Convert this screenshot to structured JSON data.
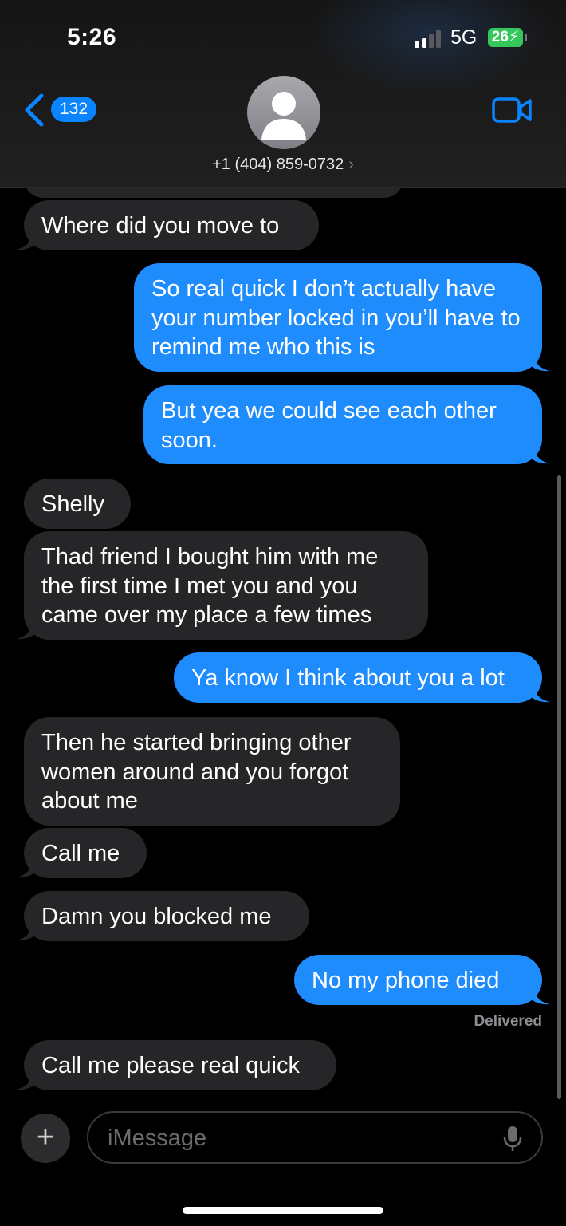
{
  "status_bar": {
    "time": "5:26",
    "network": "5G",
    "battery": "26"
  },
  "header": {
    "back_count": "132",
    "contact": "+1 (404) 859-0732",
    "contact_chevron": "›"
  },
  "messages": [
    {
      "dir": "in",
      "text": "Where did you move to"
    },
    {
      "dir": "out",
      "text": "So real quick I don’t actually have your number locked in you’ll have to remind me who this is"
    },
    {
      "dir": "out",
      "text": "But yea we could see each other soon."
    },
    {
      "dir": "in",
      "text": "Shelly"
    },
    {
      "dir": "in",
      "text": "Thad friend I bought him with me the first time I met you and you came over my place a few times"
    },
    {
      "dir": "out",
      "text": "Ya know I think about you a lot"
    },
    {
      "dir": "in",
      "text": "Then he started bringing other women around and you forgot about me"
    },
    {
      "dir": "in",
      "text": "Call me"
    },
    {
      "dir": "in",
      "text": "Damn you blocked me"
    },
    {
      "dir": "out",
      "text": "No my phone died"
    },
    {
      "dir": "in",
      "text": "Call me please real quick"
    }
  ],
  "delivered_label": "Delivered",
  "composer": {
    "plus": "+",
    "placeholder": "iMessage"
  },
  "colors": {
    "outgoing": "#1f8cfe",
    "incoming": "#262629",
    "accent": "#0a84ff",
    "battery": "#34c759"
  },
  "icons": [
    "back-chevron-icon",
    "person-icon",
    "video-camera-icon",
    "signal-icon",
    "battery-icon",
    "plus-icon",
    "microphone-icon"
  ]
}
